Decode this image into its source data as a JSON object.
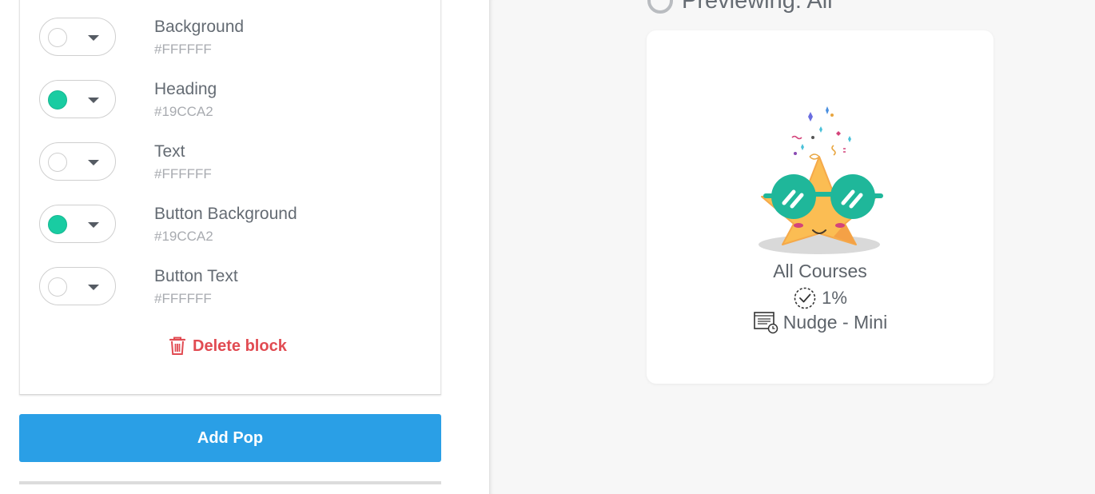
{
  "editor": {
    "colors": [
      {
        "label": "Background",
        "hex": "#FFFFFF",
        "swatch": "#FFFFFF"
      },
      {
        "label": "Heading",
        "hex": "#19CCA2",
        "swatch": "#19CCA2"
      },
      {
        "label": "Text",
        "hex": "#FFFFFF",
        "swatch": "#FFFFFF"
      },
      {
        "label": "Button Background",
        "hex": "#19CCA2",
        "swatch": "#19CCA2"
      },
      {
        "label": "Button Text",
        "hex": "#FFFFFF",
        "swatch": "#FFFFFF"
      }
    ],
    "delete_label": "Delete block",
    "delete_color": "#E14B52",
    "add_pop_label": "Add Pop",
    "add_pop_color": "#2A9FE6"
  },
  "preview": {
    "title": "Previewing: All",
    "card": {
      "illustration": "star-mascot-with-sunglasses",
      "course_title": "All Courses",
      "progress": "1%",
      "progress_icon": "check-circle-icon",
      "nudge_label": "Nudge - Mini",
      "nudge_icon": "clock-list-icon"
    }
  }
}
